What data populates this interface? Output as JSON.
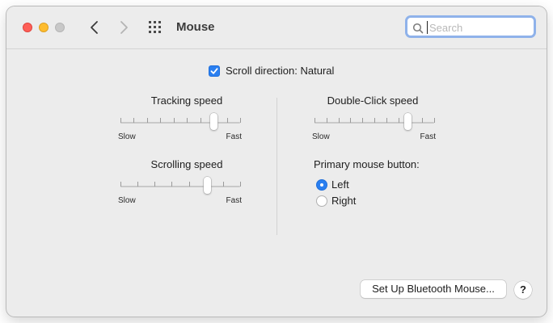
{
  "window": {
    "title": "Mouse",
    "search": {
      "placeholder": "Search",
      "value": ""
    }
  },
  "scroll_direction": {
    "label": "Scroll direction: Natural",
    "checked": true
  },
  "tracking_speed": {
    "title": "Tracking speed",
    "min_label": "Slow",
    "max_label": "Fast",
    "ticks": 10,
    "value_fraction": 0.78
  },
  "scrolling_speed": {
    "title": "Scrolling speed",
    "min_label": "Slow",
    "max_label": "Fast",
    "ticks": 8,
    "value_fraction": 0.72
  },
  "double_click_speed": {
    "title": "Double-Click speed",
    "min_label": "Slow",
    "max_label": "Fast",
    "ticks": 11,
    "value_fraction": 0.78
  },
  "primary_button": {
    "heading": "Primary mouse button:",
    "options": [
      {
        "label": "Left",
        "selected": true
      },
      {
        "label": "Right",
        "selected": false
      }
    ]
  },
  "footer": {
    "bluetooth_label": "Set Up Bluetooth Mouse...",
    "help_label": "?"
  },
  "colors": {
    "accent": "#2a7ff0",
    "close": "#fe5f57",
    "minimize": "#febc2e",
    "zoom_inactive": "#c8c8c8"
  },
  "icons": [
    "back-chevron-icon",
    "forward-chevron-icon",
    "grid-icon",
    "search-icon",
    "checkmark-icon"
  ]
}
